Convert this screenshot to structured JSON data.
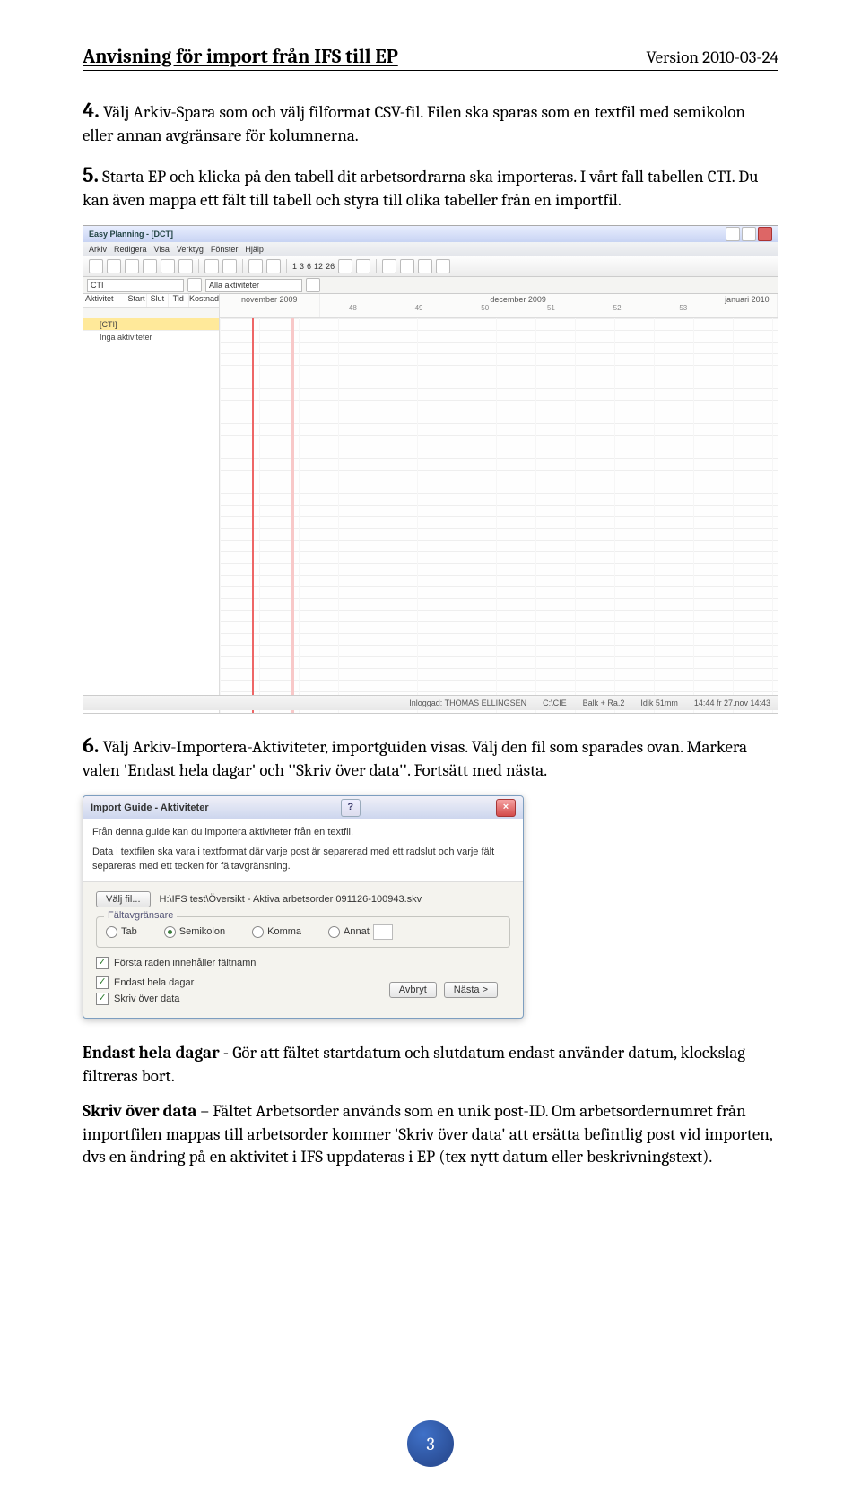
{
  "header": {
    "title": "Anvisning för import från IFS till EP",
    "version": "Version 2010-03-24"
  },
  "step4": {
    "num": "4.",
    "text": " Välj Arkiv-Spara som och välj filformat CSV-fil. Filen ska sparas som en textfil med semikolon eller annan avgränsare för kolumnerna."
  },
  "step5": {
    "num": "5.",
    "text": " Starta EP och klicka på den tabell dit arbetsordrarna ska importeras. I vårt fall tabellen CTI. Du kan även mappa ett fält till tabell och styra till olika tabeller från en importfil."
  },
  "ep": {
    "title": "Easy Planning - [DCT]",
    "menu": [
      "Arkiv",
      "Redigera",
      "Visa",
      "Verktyg",
      "Fönster",
      "Hjälp"
    ],
    "toolbar_nums": [
      "1",
      "3",
      "6",
      "12",
      "26"
    ],
    "filter_label": "CTI",
    "filter_dd": "Alla aktiviteter",
    "months": [
      "november 2009",
      "december 2009",
      "januari 2010"
    ],
    "left_cols": [
      "Aktivitet",
      "Start",
      "Slut",
      "Tid",
      "Kostnad"
    ],
    "weeks": [
      "48",
      "49",
      "50",
      "51",
      "52",
      "53"
    ],
    "table_name": "[CTI]",
    "empty_row": "Inga aktiviteter",
    "status": [
      "Inloggad: THOMAS ELLINGSEN",
      "C:\\CIE",
      "Balk + Ra.2",
      "Idik 51mm",
      "14:44  fr 27.nov  14:43"
    ]
  },
  "step6": {
    "num": "6.",
    "text": " Välj Arkiv-Importera-Aktiviteter, importguiden visas. Välj den fil som sparades ovan. Markera valen 'Endast hela dagar' och ''Skriv över data''. Fortsätt med nästa."
  },
  "dlg": {
    "title": "Import Guide - Aktiviteter",
    "intro1": "Från denna guide kan du importera aktiviteter från en textfil.",
    "intro2": "Data i textfilen ska vara i textformat där varje post är separerad med ett radslut och varje fält separeras med ett tecken för fältavgränsning.",
    "file_btn": "Välj fil...",
    "file_path": "H:\\IFS test\\Översikt - Aktiva arbetsorder 091126-100943.skv",
    "group": "Fältavgränsare",
    "radios": [
      "Tab",
      "Semikolon",
      "Komma",
      "Annat"
    ],
    "selected_radio": "Semikolon",
    "chk1": "Första raden innehåller fältnamn",
    "chk2": "Endast hela dagar",
    "chk3": "Skriv över data",
    "btn_cancel": "Avbryt",
    "btn_next": "Nästa >"
  },
  "desc1": {
    "lead": "Endast hela dagar",
    "rest": " - Gör att fältet startdatum och slutdatum endast använder datum, klockslag filtreras bort."
  },
  "desc2": {
    "lead": "Skriv över data",
    "rest": " – Fältet Arbetsorder används som en unik post-ID. Om arbetsordernumret från importfilen mappas till arbetsorder kommer 'Skriv över data' att ersätta befintlig post vid importen, dvs en ändring på en aktivitet i IFS uppdateras i EP (tex nytt datum eller beskrivningstext)."
  },
  "pagenum": "3"
}
